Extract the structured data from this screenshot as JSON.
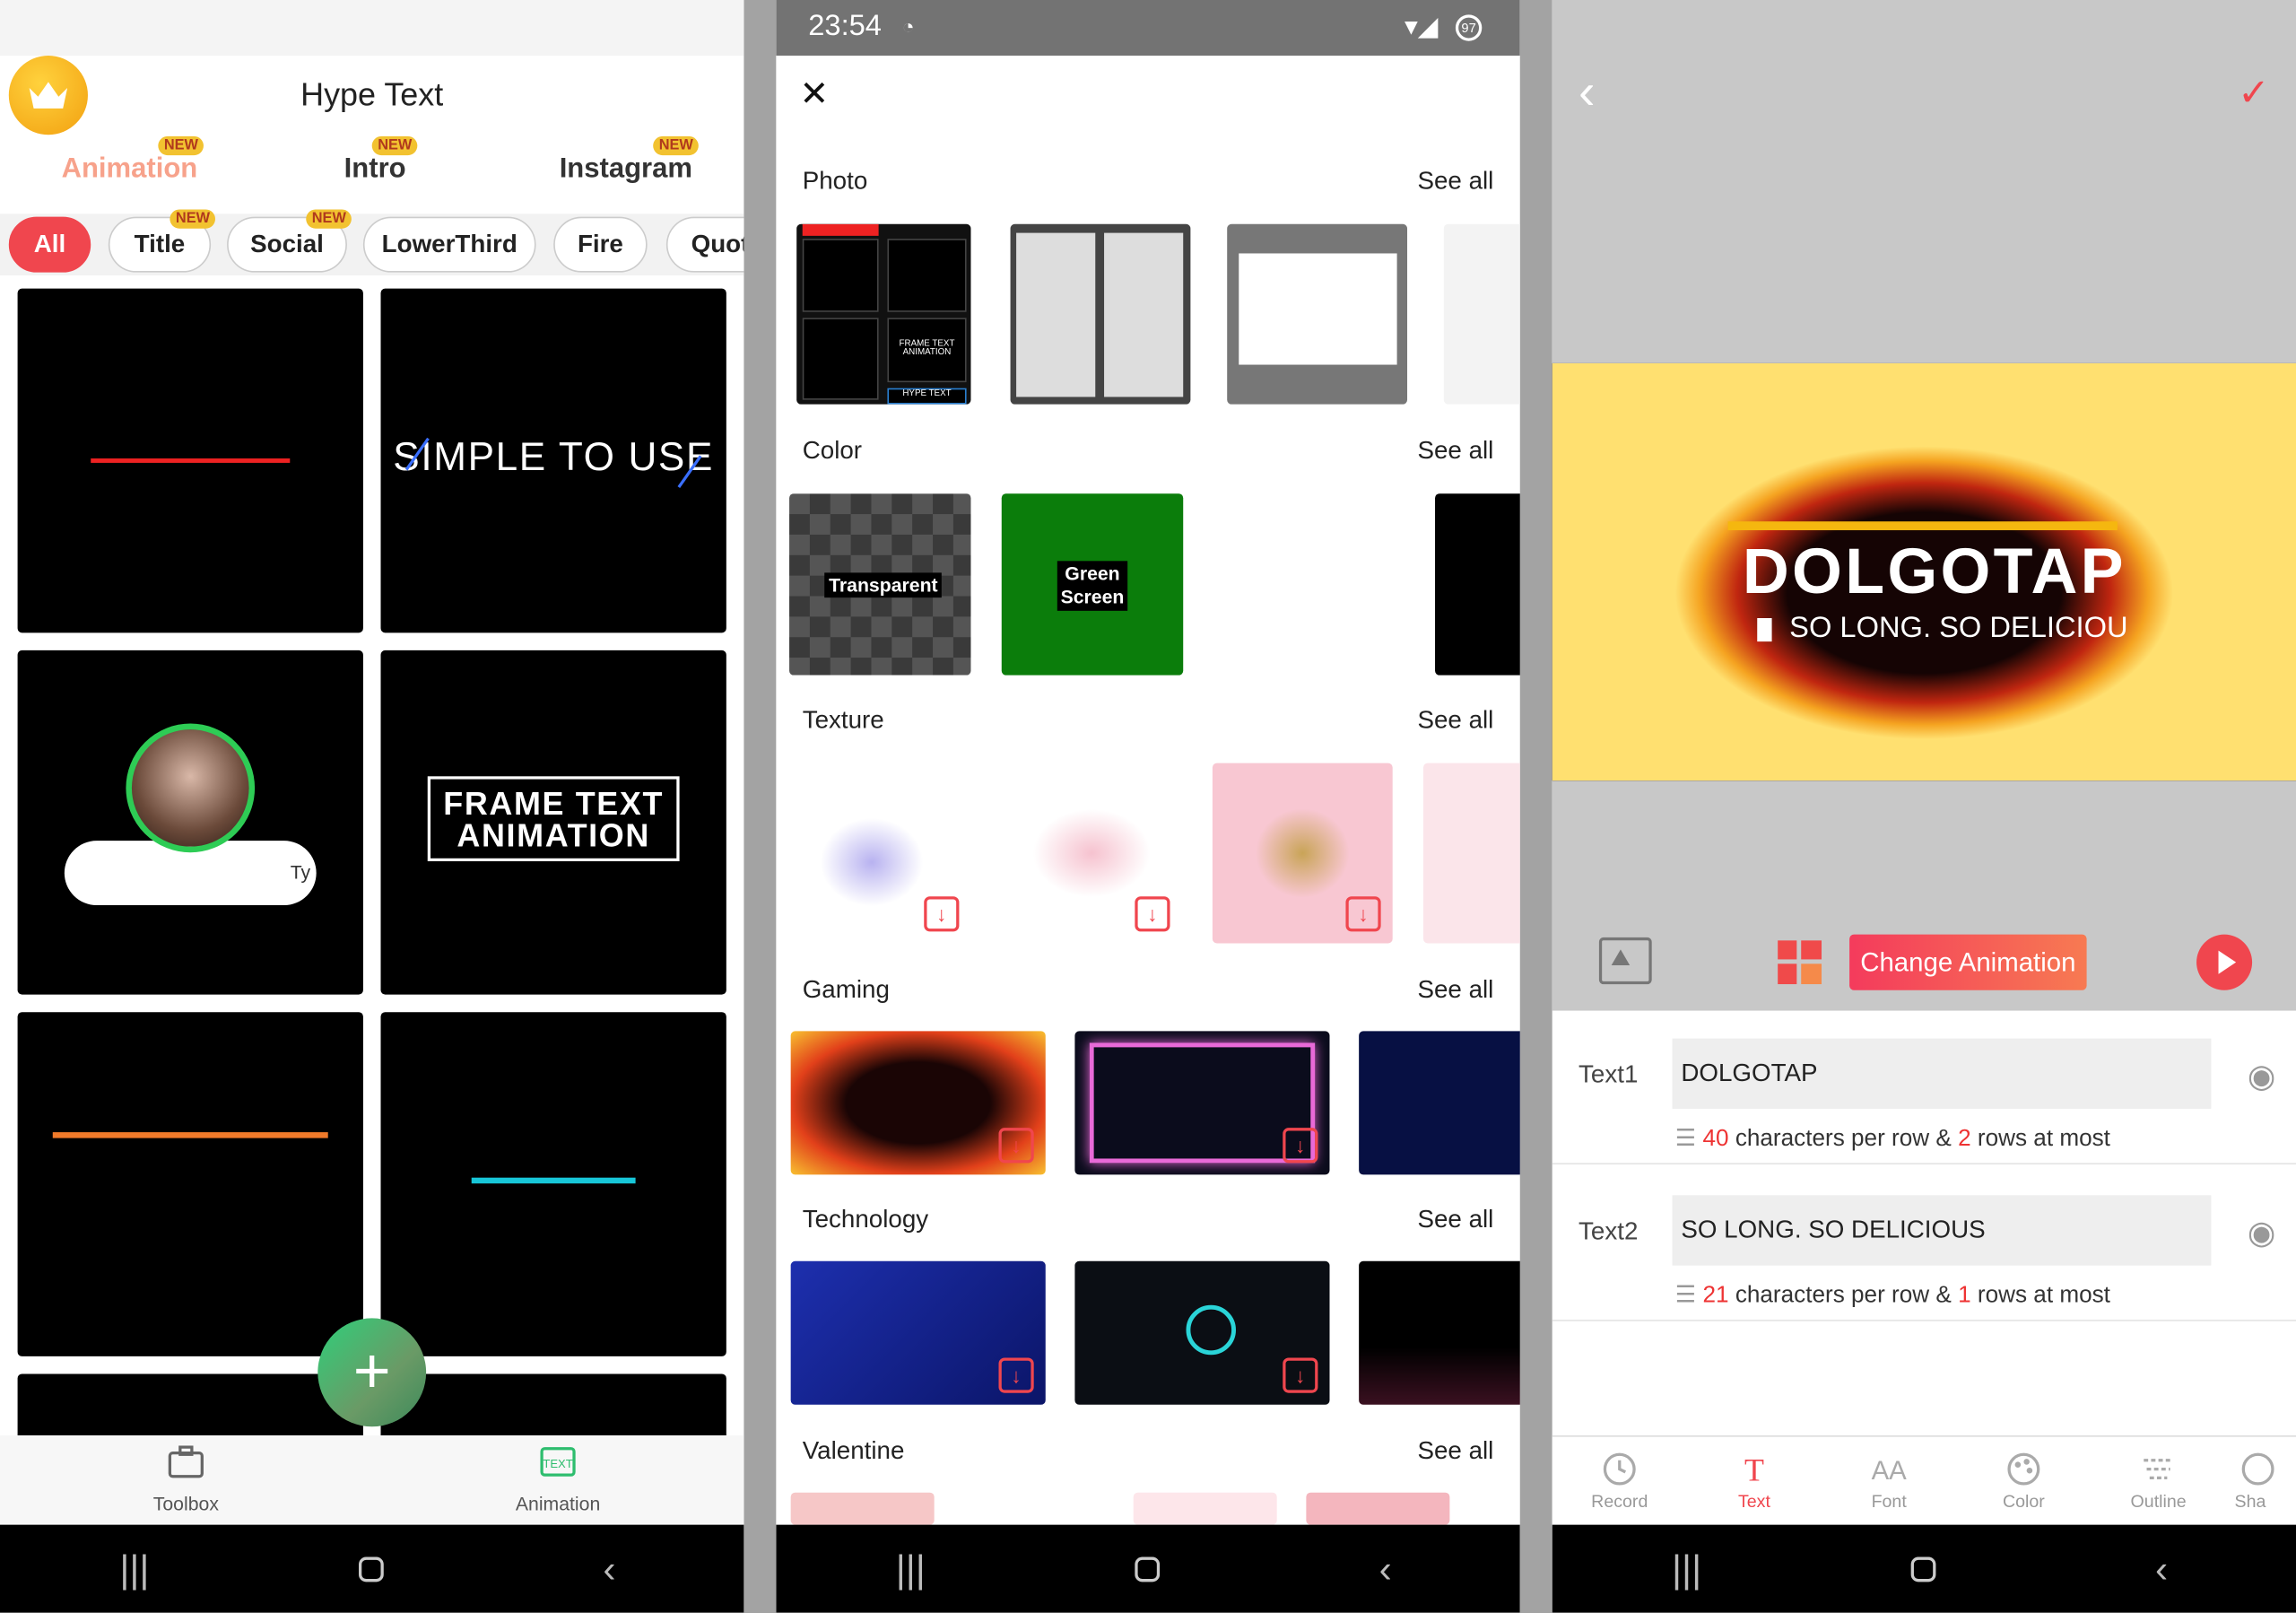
{
  "panel1": {
    "title": "Hype Text",
    "tabs": [
      {
        "label": "Animation",
        "badge": "NEW"
      },
      {
        "label": "Intro",
        "badge": "NEW"
      },
      {
        "label": "Instagram",
        "badge": "NEW"
      }
    ],
    "chips": [
      {
        "label": "All",
        "badge": ""
      },
      {
        "label": "Title",
        "badge": "NEW"
      },
      {
        "label": "Social",
        "badge": "NEW"
      },
      {
        "label": "LowerThird",
        "badge": ""
      },
      {
        "label": "Fire",
        "badge": ""
      },
      {
        "label": "Quote",
        "badge": ""
      }
    ],
    "tiles": {
      "simple": "SIMPLE TO USE",
      "frame": "FRAME TEXT\nANIMATION",
      "bubble": "Ty"
    },
    "bottom_tabs": [
      {
        "label": "Toolbox",
        "icon": "toolbox-icon"
      },
      {
        "label": "Animation",
        "icon": "text-animation-icon"
      }
    ]
  },
  "panel2": {
    "status": {
      "time": "23:54",
      "battery": "97"
    },
    "sections": [
      {
        "title": "Photo",
        "see_all": "See all"
      },
      {
        "title": "Color",
        "see_all": "See all"
      },
      {
        "title": "Texture",
        "see_all": "See all"
      },
      {
        "title": "Gaming",
        "see_all": "See all"
      },
      {
        "title": "Technology",
        "see_all": "See all"
      },
      {
        "title": "Valentine",
        "see_all": "See all"
      }
    ],
    "color_items": [
      "Transparent",
      "Green Screen"
    ],
    "photo_thumb_text": [
      "FRAME TEXT ANIMATION",
      "HYPE TEXT"
    ]
  },
  "panel3": {
    "preview": {
      "title": "DOLGOTAP",
      "subtitle": "SO LONG. SO DELICIOU"
    },
    "change_button": "Change Animation",
    "text_fields": [
      {
        "label": "Text1",
        "value": "DOLGOTAP",
        "limit_chars": "40",
        "limit_mid": " characters per row & ",
        "limit_rows": "2",
        "limit_end": " rows at most"
      },
      {
        "label": "Text2",
        "value": "SO LONG. SO DELICIOUS",
        "limit_chars": "21",
        "limit_mid": " characters per row & ",
        "limit_rows": "1",
        "limit_end": " rows at most"
      }
    ],
    "tools": [
      {
        "label": "Record",
        "icon": "record-icon"
      },
      {
        "label": "Text",
        "icon": "text-icon"
      },
      {
        "label": "Font",
        "icon": "font-icon"
      },
      {
        "label": "Color",
        "icon": "palette-icon"
      },
      {
        "label": "Outline",
        "icon": "outline-icon"
      },
      {
        "label": "Sha",
        "icon": "shadow-icon"
      }
    ]
  },
  "colors": {
    "accent": "#f0464e",
    "gold": "#f2c230",
    "green_screen": "#0b7d0b"
  }
}
